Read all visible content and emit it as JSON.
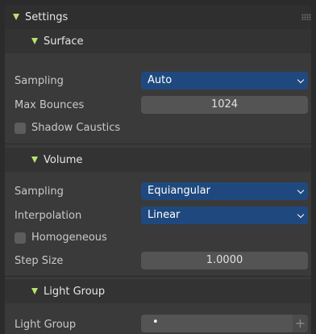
{
  "settings": {
    "title": "Settings",
    "surface": {
      "title": "Surface",
      "sampling_label": "Sampling",
      "sampling_value": "Auto",
      "max_bounces_label": "Max Bounces",
      "max_bounces_value": "1024",
      "shadow_caustics_label": "Shadow Caustics",
      "shadow_caustics_checked": false
    },
    "volume": {
      "title": "Volume",
      "sampling_label": "Sampling",
      "sampling_value": "Equiangular",
      "interpolation_label": "Interpolation",
      "interpolation_value": "Linear",
      "homogeneous_label": "Homogeneous",
      "homogeneous_checked": false,
      "step_size_label": "Step Size",
      "step_size_value": "1.0000"
    },
    "light_group": {
      "title": "Light Group",
      "field_label": "Light Group",
      "field_value": "•",
      "add_label": "+"
    }
  },
  "colors": {
    "accent_triangle": "#b7e36f",
    "dropdown_bg": "#1f497e",
    "panel_bg": "#3a3a3a",
    "field_bg": "#545454"
  }
}
